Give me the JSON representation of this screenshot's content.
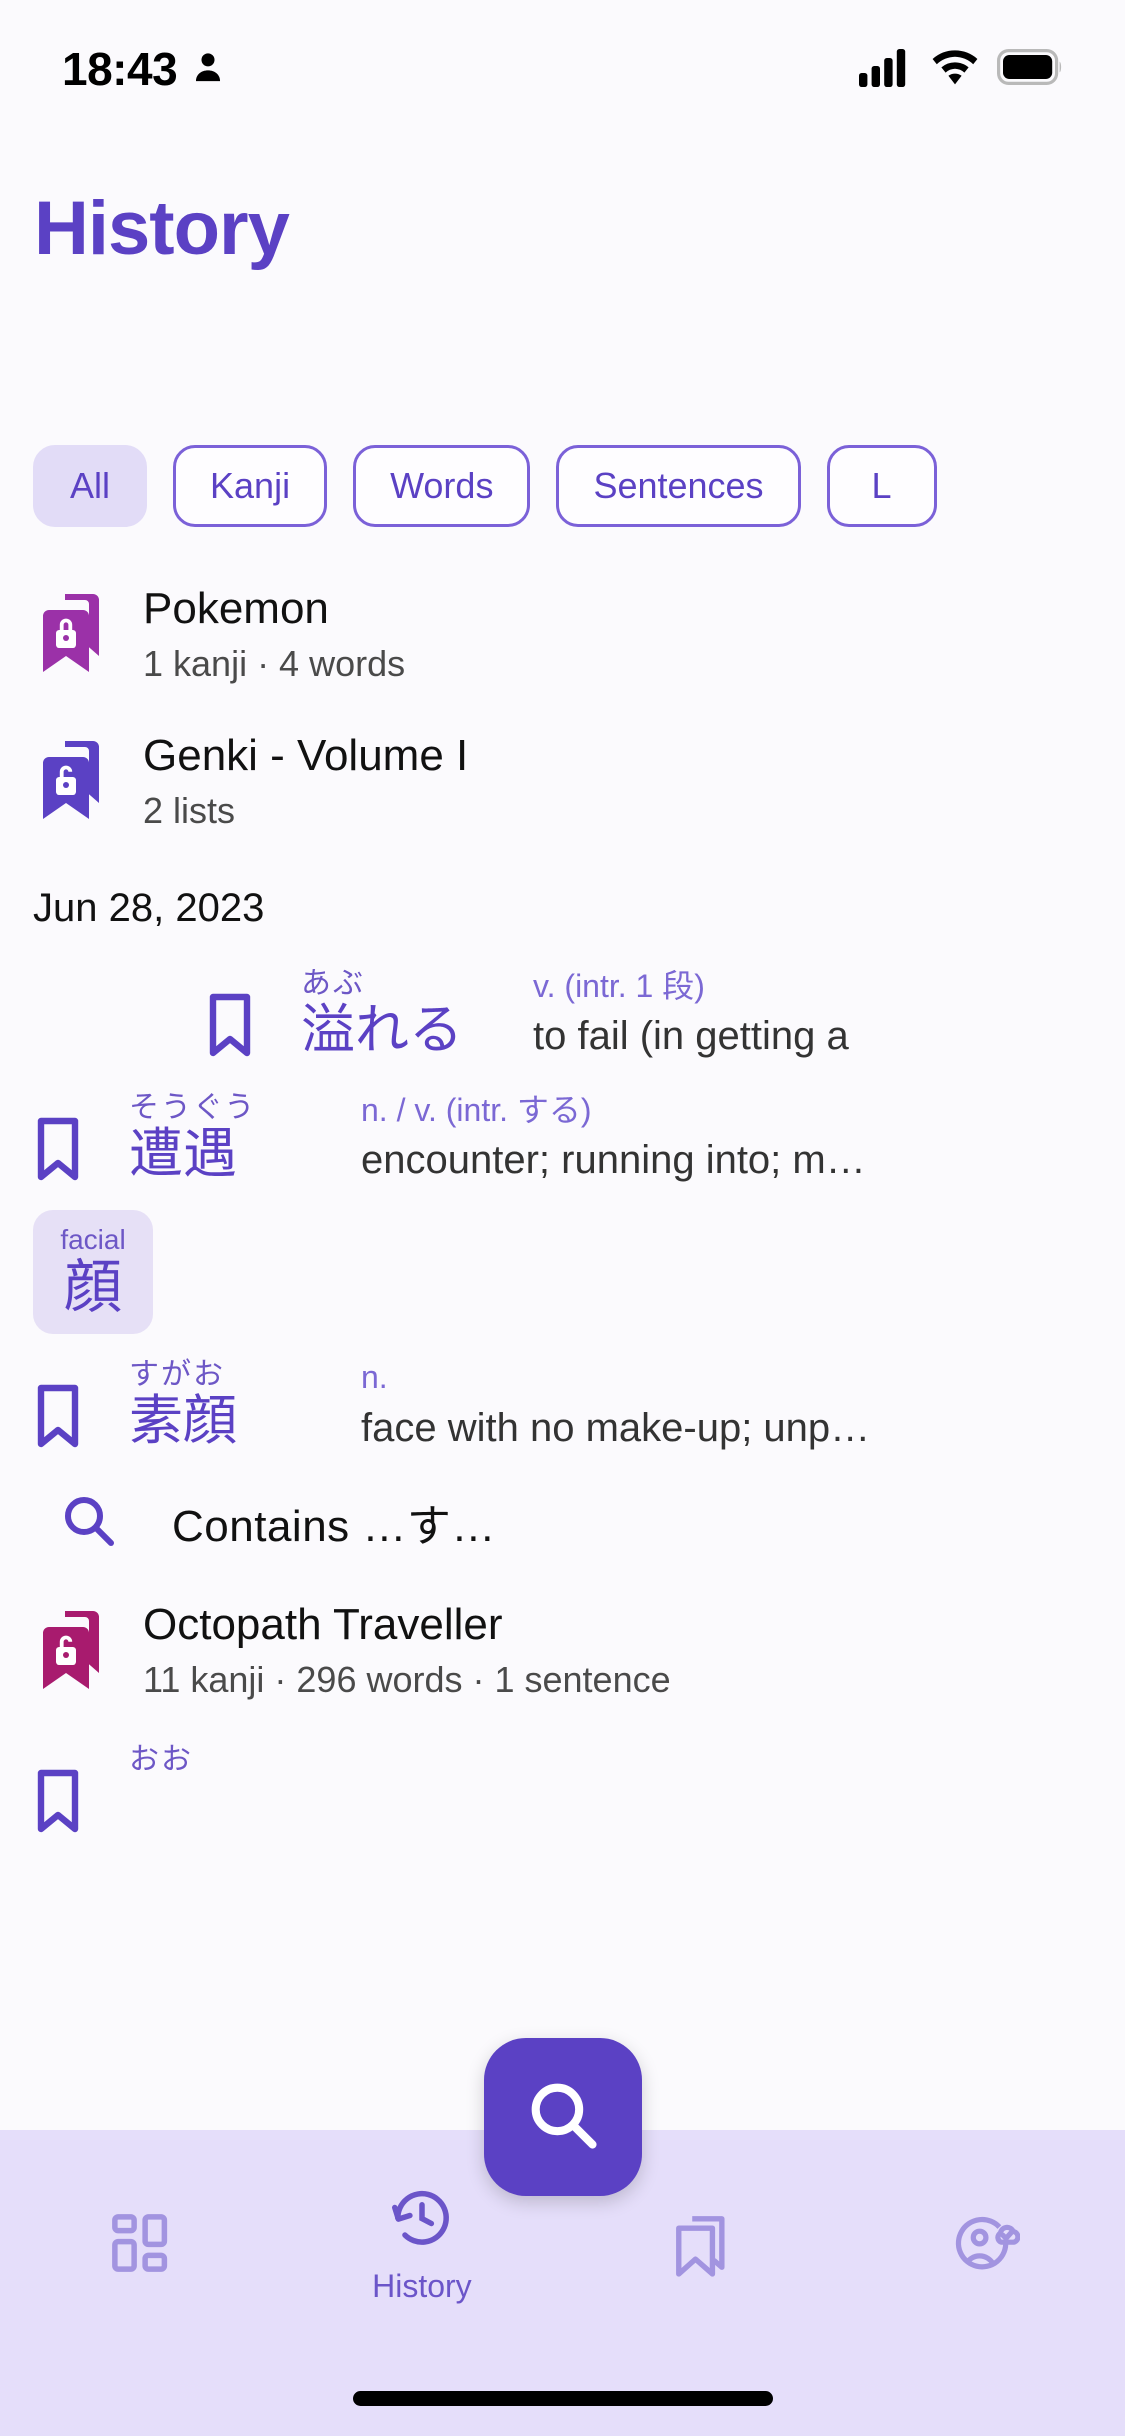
{
  "status_bar": {
    "time": "18:43",
    "icons": [
      "person-icon",
      "cellular-signal-icon",
      "wifi-icon",
      "battery-icon"
    ]
  },
  "header": {
    "title": "History"
  },
  "filters": {
    "chips": [
      {
        "label": "All",
        "selected": true
      },
      {
        "label": "Kanji",
        "selected": false
      },
      {
        "label": "Words",
        "selected": false
      },
      {
        "label": "Sentences",
        "selected": false
      },
      {
        "label": "L",
        "selected": false
      }
    ]
  },
  "lists": [
    {
      "title": "Pokemon",
      "subtitle": "1 kanji · 4 words",
      "icon": "locked-bookmark-stack-icon",
      "color": "#9B31A8"
    },
    {
      "title": "Genki - Volume I",
      "subtitle": "2 lists",
      "icon": "unlocked-bookmark-stack-icon",
      "color": "#5B41C4"
    }
  ],
  "date_header": "Jun 28, 2023",
  "entries": [
    {
      "type": "word",
      "furigana": "あぶ",
      "kanji": "溢れる",
      "pos": "v. (intr. 1 段)",
      "meaning": "to fail (in getting a",
      "bookmark": "bookmark-outline-icon",
      "shifted": true
    },
    {
      "type": "word",
      "furigana": "そうぐう",
      "kanji": "遭遇",
      "pos": "n. / v. (intr. する)",
      "meaning": "encounter; running into; m…",
      "bookmark": "bookmark-outline-icon",
      "shifted": false
    },
    {
      "type": "kanji_card",
      "label": "facial",
      "character": "顔"
    },
    {
      "type": "word",
      "furigana": "すがお",
      "kanji": "素顔",
      "pos": "n.",
      "meaning": "face with no make-up; unp…",
      "bookmark": "bookmark-outline-icon",
      "shifted": false
    },
    {
      "type": "search",
      "label": "Contains  …す…",
      "icon": "search-icon"
    },
    {
      "type": "list",
      "title": "Octopath Traveller",
      "subtitle": "11 kanji · 296 words · 1 sentence",
      "icon": "unlocked-bookmark-stack-icon",
      "color": "#A81B6E"
    },
    {
      "type": "word_partial",
      "furigana": "おお",
      "bookmark": "bookmark-outline-icon"
    }
  ],
  "fab": {
    "icon": "search-icon",
    "color": "#5B41C4"
  },
  "bottom_nav": {
    "items": [
      {
        "icon": "dashboard-grid-icon",
        "label": "",
        "active": false
      },
      {
        "icon": "history-clock-icon",
        "label": "History",
        "active": true
      },
      {
        "icon": "bookmark-stack-icon",
        "label": "",
        "active": false
      },
      {
        "icon": "profile-cloud-sync-icon",
        "label": "",
        "active": false
      }
    ]
  },
  "colors": {
    "primary": "#5B41C4",
    "chip_selected_bg": "#E2DCF7",
    "nav_bg": "#E5DEFA",
    "page_bg": "#FBFAFD"
  }
}
